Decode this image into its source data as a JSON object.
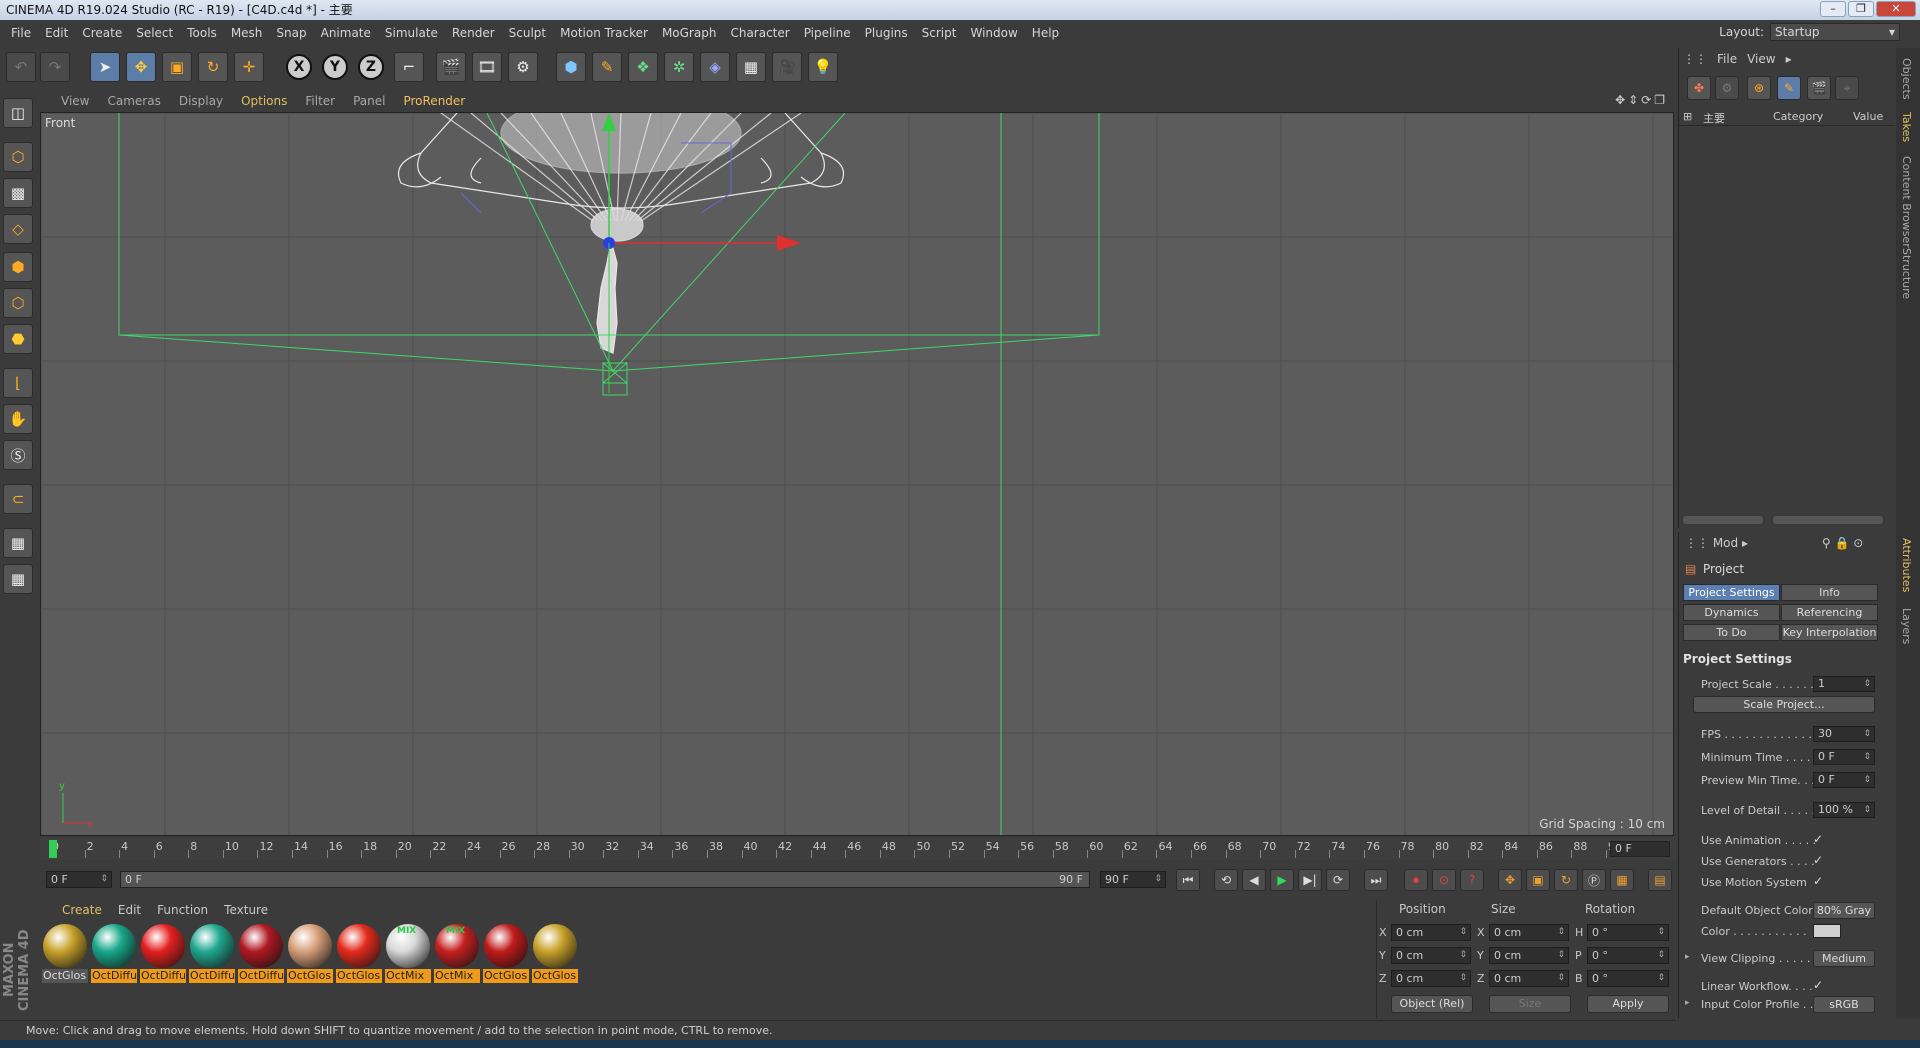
{
  "window": {
    "title": "CINEMA 4D R19.024 Studio (RC - R19) - [C4D.c4d *] - 主要"
  },
  "menu": {
    "items": [
      "File",
      "Edit",
      "Create",
      "Select",
      "Tools",
      "Mesh",
      "Snap",
      "Animate",
      "Simulate",
      "Render",
      "Sculpt",
      "Motion Tracker",
      "MoGraph",
      "Character",
      "Pipeline",
      "Plugins",
      "Script",
      "Window",
      "Help"
    ],
    "layout_label": "Layout:",
    "layout_value": "Startup"
  },
  "toolbar": {
    "axis_x": "X",
    "axis_y": "Y",
    "axis_z": "Z"
  },
  "viewport": {
    "menu": [
      "View",
      "Cameras",
      "Display",
      "Options",
      "Filter",
      "Panel",
      "ProRender"
    ],
    "label": "Front",
    "grid_spacing": "Grid Spacing : 10 cm",
    "axis_y": "y",
    "axis_x": "x",
    "colors": {
      "background": "#5c5c5c",
      "camera": "#3fd86a",
      "x_axis": "#e03030",
      "y_axis": "#30d040",
      "z_axis": "#2a3fe0"
    }
  },
  "timeline": {
    "ticks": [
      "0",
      "2",
      "4",
      "6",
      "8",
      "10",
      "12",
      "14",
      "16",
      "18",
      "20",
      "22",
      "24",
      "26",
      "28",
      "30",
      "32",
      "34",
      "36",
      "38",
      "40",
      "42",
      "44",
      "46",
      "48",
      "50",
      "52",
      "54",
      "56",
      "58",
      "60",
      "62",
      "64",
      "66",
      "68",
      "70",
      "72",
      "74",
      "76",
      "78",
      "80",
      "82",
      "84",
      "86",
      "88",
      "90"
    ],
    "current_frame": "0 F"
  },
  "transport": {
    "start_field": "0 F",
    "range_left": "0 F",
    "range_right": "90 F",
    "end_field": "90 F"
  },
  "materials": {
    "menu": [
      "Create",
      "Edit",
      "Function",
      "Texture"
    ],
    "items": [
      {
        "label": "OctGlos",
        "color": "#c9a22a"
      },
      {
        "label": "OctDiffu",
        "color": "#18a88a"
      },
      {
        "label": "OctDiffu",
        "color": "#e42020"
      },
      {
        "label": "OctDiffu",
        "color": "#20a890"
      },
      {
        "label": "OctDiffu",
        "color": "#b01822"
      },
      {
        "label": "OctGlos",
        "color": "#d8a07a"
      },
      {
        "label": "OctGlos",
        "color": "#e42a1c"
      },
      {
        "label": "OctMix",
        "color": "#d8d8d8"
      },
      {
        "label": "OctMix",
        "color": "#c52020"
      },
      {
        "label": "OctGlos",
        "color": "#c01a1a"
      },
      {
        "label": "OctGlos",
        "color": "#c9a22a"
      }
    ],
    "mix_badge": "MIX",
    "logo": "MAXON CINEMA 4D"
  },
  "coords": {
    "headers": {
      "position": "Position",
      "size": "Size",
      "rotation": "Rotation"
    },
    "rows": [
      {
        "a1": "X",
        "v1": "0 cm",
        "a2": "X",
        "v2": "0 cm",
        "a3": "H",
        "v3": "0 °"
      },
      {
        "a1": "Y",
        "v1": "0 cm",
        "a2": "Y",
        "v2": "0 cm",
        "a3": "P",
        "v3": "0 °"
      },
      {
        "a1": "Z",
        "v1": "0 cm",
        "a2": "Z",
        "v2": "0 cm",
        "a3": "B",
        "v3": "0 °"
      }
    ],
    "mode": "Object (Rel)",
    "size_mode": "Size",
    "apply": "Apply"
  },
  "status": {
    "text": "Move: Click and drag to move elements. Hold down SHIFT to quantize movement / add to the selection in point mode, CTRL to remove."
  },
  "objects": {
    "menu": [
      "File",
      "View"
    ],
    "root": "主要",
    "col_category": "Category",
    "col_value": "Value"
  },
  "right_tabs": [
    "Objects",
    "Takes",
    "Content Browser",
    "Structure",
    "Attributes",
    "Layers"
  ],
  "attributes": {
    "mode": "Mod",
    "object": "Project",
    "tabs": [
      "Project Settings",
      "Info",
      "Dynamics",
      "Referencing",
      "To Do",
      "Key Interpolation"
    ],
    "section": "Project Settings",
    "project_scale_label": "Project Scale . . . . . .",
    "project_scale": "1",
    "scale_project": "Scale Project...",
    "fps_label": "FPS . . . . . . . . . . . . . .",
    "fps": "30",
    "min_time_label": "Minimum Time . . . .",
    "min_time": "0 F",
    "preview_min_label": "Preview Min Time. . .",
    "preview_min": "0 F",
    "lod_label": "Level of Detail . . . . .",
    "lod": "100 %",
    "use_animation_label": "Use Animation . . . . .",
    "use_generators_label": "Use Generators . . . .",
    "use_motion_label": "Use Motion System",
    "check": "✓",
    "default_color_label": "Default Object Color",
    "default_color": "80% Gray",
    "color_label": "Color . . . . . . . . . . .",
    "view_clipping_label": "View Clipping . . . . . .",
    "view_clipping": "Medium",
    "linear_workflow_label": "Linear Workflow. . . .",
    "input_profile_label": "Input Color Profile . .",
    "input_profile": "sRGB"
  }
}
